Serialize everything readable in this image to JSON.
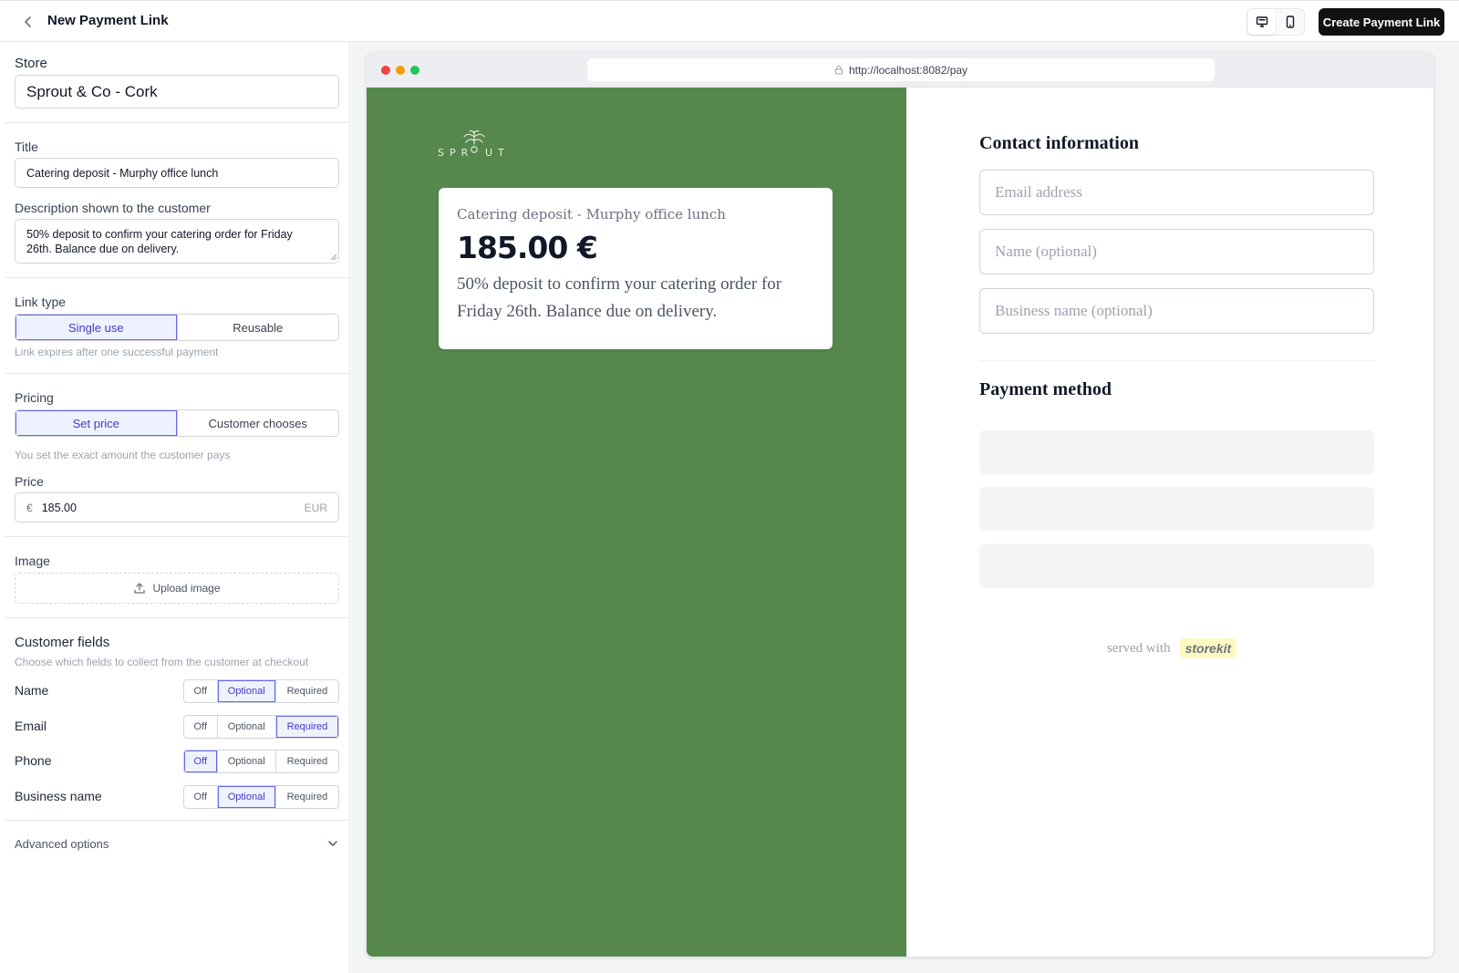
{
  "header": {
    "title": "New Payment Link",
    "create_label": "Create Payment Link"
  },
  "form": {
    "store": {
      "label": "Store",
      "value": "Sprout & Co - Cork"
    },
    "title": {
      "label": "Title",
      "value": "Catering deposit - Murphy office lunch"
    },
    "description": {
      "label": "Description shown to the customer",
      "value": "50% deposit to confirm your catering order for Friday 26th. Balance due on delivery."
    },
    "link_type": {
      "label": "Link type",
      "options": [
        "Single use",
        "Reusable"
      ],
      "selected": "Single use",
      "hint": "Link expires after one successful payment"
    },
    "pricing": {
      "label": "Pricing",
      "options": [
        "Set price",
        "Customer chooses"
      ],
      "selected": "Set price",
      "hint": "You set the exact amount the customer pays"
    },
    "price": {
      "label": "Price",
      "currency_symbol": "€",
      "value": "185.00",
      "currency": "EUR"
    },
    "image": {
      "label": "Image",
      "upload_label": "Upload image"
    },
    "customer_fields": {
      "label": "Customer fields",
      "hint": "Choose which fields to collect from the customer at checkout",
      "options": [
        "Off",
        "Optional",
        "Required"
      ],
      "fields": [
        {
          "name": "Name",
          "selected": "Optional"
        },
        {
          "name": "Email",
          "selected": "Required"
        },
        {
          "name": "Phone",
          "selected": "Off"
        },
        {
          "name": "Business name",
          "selected": "Optional"
        }
      ]
    },
    "advanced": {
      "label": "Advanced options"
    }
  },
  "preview": {
    "url": "http://localhost:8082/pay",
    "brand_color": "#56884d",
    "logo_text": "SPROUT",
    "card": {
      "title": "Catering deposit - Murphy office lunch",
      "price": "185.00 €",
      "description": "50% deposit to confirm your catering order for Friday 26th. Balance due on delivery."
    },
    "contact": {
      "heading": "Contact information",
      "email_placeholder": "Email address",
      "name_placeholder": "Name (optional)",
      "business_placeholder": "Business name (optional)"
    },
    "payment": {
      "heading": "Payment method"
    },
    "footer": {
      "served_with": "served with",
      "brand": "storekit"
    }
  },
  "icons": {
    "back": "chevron-left-icon",
    "desktop": "monitor-icon",
    "mobile": "smartphone-icon",
    "upload": "upload-icon",
    "advanced": "chevron-down-icon",
    "lock": "lock-icon"
  },
  "colors": {
    "accent": "#6366f1",
    "accent_bg": "#eef2ff",
    "primary_button": "#111111"
  }
}
